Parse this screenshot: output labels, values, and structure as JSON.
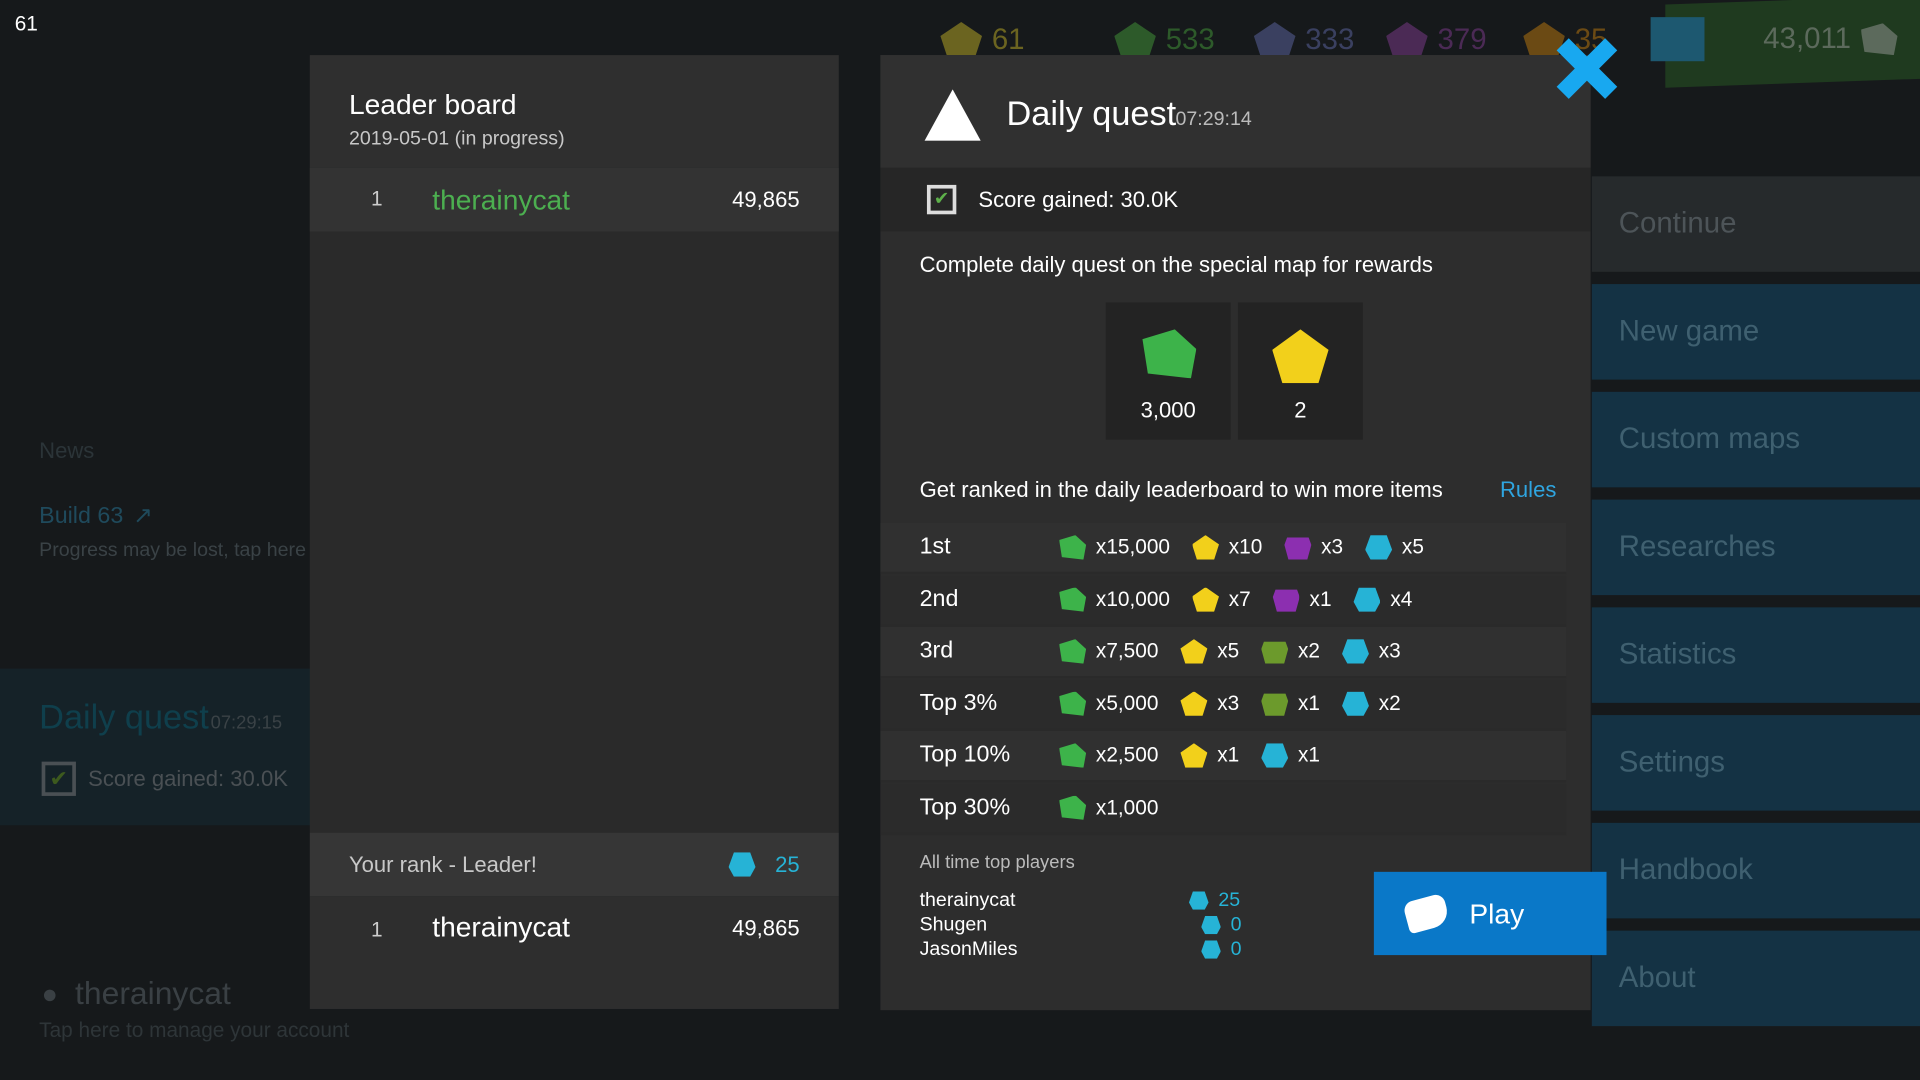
{
  "fps": "61",
  "resources": [
    {
      "name": "crystals",
      "value": "61",
      "color": "#6b6420"
    },
    {
      "name": "green",
      "value": "533",
      "color": "#2d5a2a"
    },
    {
      "name": "blue",
      "value": "333",
      "color": "#3a4060"
    },
    {
      "name": "purple",
      "value": "379",
      "color": "#4b2a55"
    },
    {
      "name": "orange",
      "value": "35",
      "color": "#6b4a14"
    }
  ],
  "money": "43,011",
  "close_icon": "close-x",
  "menu": [
    "Continue",
    "New game",
    "Custom maps",
    "Researches",
    "Statistics",
    "Settings",
    "Handbook",
    "About"
  ],
  "background": {
    "news_title": "News",
    "news_link": "Build 63",
    "news_text": "Progress may be lost, tap here fo",
    "daily_title": "Daily quest",
    "daily_time": "07:29:15",
    "daily_score": "Score gained: 30.0K",
    "username": "therainycat",
    "account_hint": "Tap here to manage your account"
  },
  "leaderboard": {
    "title": "Leader board",
    "subtitle": "2019-05-01 (in progress)",
    "rows": [
      {
        "rank": "1",
        "name": "therainycat",
        "score": "49,865"
      }
    ],
    "your_rank_label": "Your rank - Leader!",
    "your_rank_caps": "25",
    "your_row": {
      "rank": "1",
      "name": "therainycat",
      "score": "49,865"
    }
  },
  "daily_quest": {
    "title": "Daily quest",
    "timer": "07:29:14",
    "score": "Score gained: 30.0K",
    "description": "Complete daily quest on the special map for rewards",
    "rewards": [
      {
        "icon": "cash",
        "value": "3,000"
      },
      {
        "icon": "crystal",
        "value": "2"
      }
    ],
    "ranked_text": "Get ranked in the daily leaderboard to win more items",
    "rules_label": "Rules",
    "tiers": [
      {
        "label": "1st",
        "items": [
          {
            "icon": "cash",
            "qty": "x15,000"
          },
          {
            "icon": "crystal",
            "qty": "x10"
          },
          {
            "icon": "purple-box",
            "qty": "x3"
          },
          {
            "icon": "cap",
            "qty": "x5"
          }
        ]
      },
      {
        "label": "2nd",
        "items": [
          {
            "icon": "cash",
            "qty": "x10,000"
          },
          {
            "icon": "crystal",
            "qty": "x7"
          },
          {
            "icon": "purple-box",
            "qty": "x1"
          },
          {
            "icon": "cap",
            "qty": "x4"
          }
        ]
      },
      {
        "label": "3rd",
        "items": [
          {
            "icon": "cash",
            "qty": "x7,500"
          },
          {
            "icon": "crystal",
            "qty": "x5"
          },
          {
            "icon": "green-box",
            "qty": "x2"
          },
          {
            "icon": "cap",
            "qty": "x3"
          }
        ]
      },
      {
        "label": "Top 3%",
        "items": [
          {
            "icon": "cash",
            "qty": "x5,000"
          },
          {
            "icon": "crystal",
            "qty": "x3"
          },
          {
            "icon": "green-box",
            "qty": "x1"
          },
          {
            "icon": "cap",
            "qty": "x2"
          }
        ]
      },
      {
        "label": "Top 10%",
        "items": [
          {
            "icon": "cash",
            "qty": "x2,500"
          },
          {
            "icon": "crystal",
            "qty": "x1"
          },
          {
            "icon": "cap",
            "qty": "x1"
          }
        ]
      },
      {
        "label": "Top 30%",
        "items": [
          {
            "icon": "cash",
            "qty": "x1,000"
          }
        ]
      }
    ],
    "all_time_title": "All time top players",
    "all_time": [
      {
        "name": "therainycat",
        "caps": "25"
      },
      {
        "name": "Shugen",
        "caps": "0"
      },
      {
        "name": "JasonMiles",
        "caps": "0"
      }
    ],
    "play_label": "Play"
  }
}
